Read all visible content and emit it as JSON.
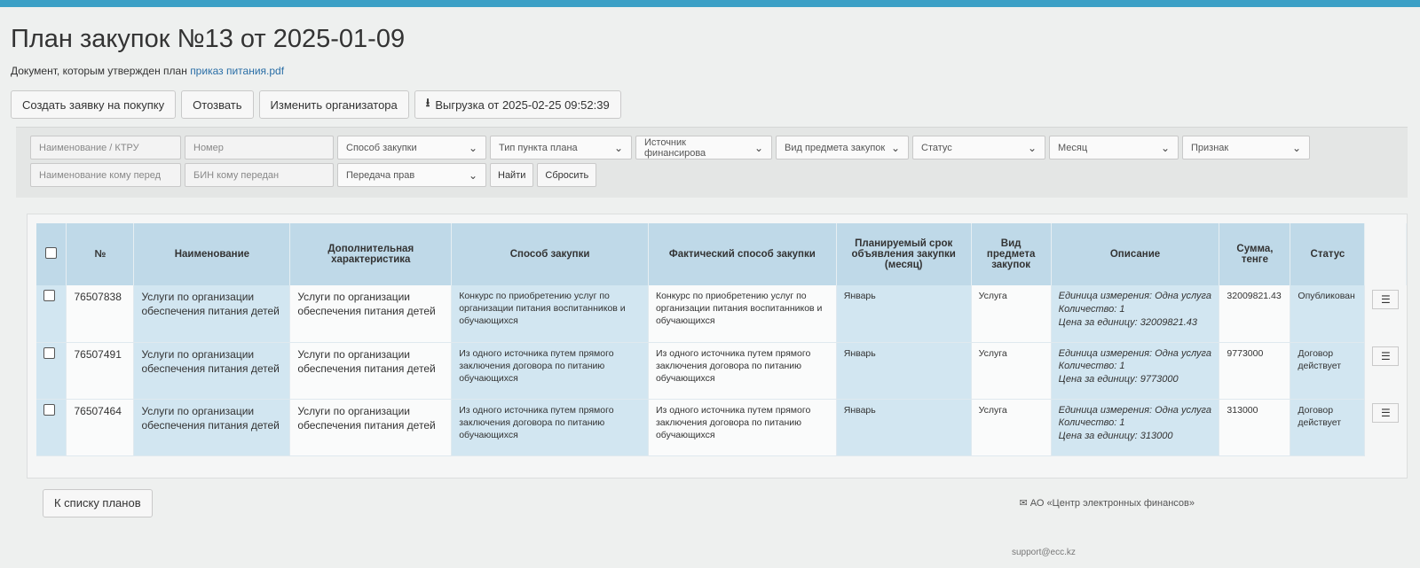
{
  "page": {
    "title": "План закупок №13 от 2025-01-09",
    "doc_label": "Документ, которым утвержден план",
    "doc_link": "приказ питания.pdf"
  },
  "actions": {
    "create": "Создать заявку на покупку",
    "recall": "Отозвать",
    "change_org": "Изменить организатора",
    "export": "Выгрузка от 2025-02-25 09:52:39"
  },
  "filters": {
    "name_ktru": "Наименование / КТРУ",
    "number": "Номер",
    "method": "Способ закупки",
    "item_type": "Тип пункта плана",
    "funding": "Источник финансирова",
    "subject": "Вид предмета закупок",
    "status": "Статус",
    "month": "Месяц",
    "sign": "Признак",
    "to_name": "Наименование кому перед",
    "to_bin": "БИН кому передан",
    "rights": "Передача прав",
    "find": "Найти",
    "reset": "Сбросить"
  },
  "table": {
    "headers": {
      "num": "№",
      "name": "Наименование",
      "extra": "Дополнительная характеристика",
      "method": "Способ закупки",
      "fact_method": "Фактический способ закупки",
      "planned": "Планируемый срок объявления закупки (месяц)",
      "kind": "Вид предмета закупок",
      "desc": "Описание",
      "sum": "Сумма, тенге",
      "status": "Статус"
    },
    "desc_labels": {
      "unit": "Единица измерения:",
      "qty": "Количество:",
      "price": "Цена за единицу:"
    },
    "rows": [
      {
        "num": "76507838",
        "name": "Услуги по организации обеспечения питания детей",
        "extra": "Услуги по организации обеспечения питания детей",
        "method": "Конкурс по приобретению услуг по организации питания воспитанников и обучающихся",
        "fact_method": "Конкурс по приобретению услуг по организации питания воспитанников и обучающихся",
        "planned": "Январь",
        "kind": "Услуга",
        "unit": "Одна услуга",
        "qty": "1",
        "price": "32009821.43",
        "sum": "32009821.43",
        "status": "Опубликован"
      },
      {
        "num": "76507491",
        "name": "Услуги по организации обеспечения питания детей",
        "extra": "Услуги по организации обеспечения питания детей",
        "method": "Из одного источника путем прямого заключения договора по питанию обучающихся",
        "fact_method": "Из одного источника путем прямого заключения договора по питанию обучающихся",
        "planned": "Январь",
        "kind": "Услуга",
        "unit": "Одна услуга",
        "qty": "1",
        "price": "9773000",
        "sum": "9773000",
        "status": "Договор действует"
      },
      {
        "num": "76507464",
        "name": "Услуги по организации обеспечения питания детей",
        "extra": "Услуги по организации обеспечения питания детей",
        "method": "Из одного источника путем прямого заключения договора по питанию обучающихся",
        "fact_method": "Из одного источника путем прямого заключения договора по питанию обучающихся",
        "planned": "Январь",
        "kind": "Услуга",
        "unit": "Одна услуга",
        "qty": "1",
        "price": "313000",
        "sum": "313000",
        "status": "Договор действует"
      }
    ]
  },
  "footer": {
    "back": "К списку планов",
    "org": "АО «Центр электронных финансов»",
    "email": "support@ecc.kz"
  }
}
